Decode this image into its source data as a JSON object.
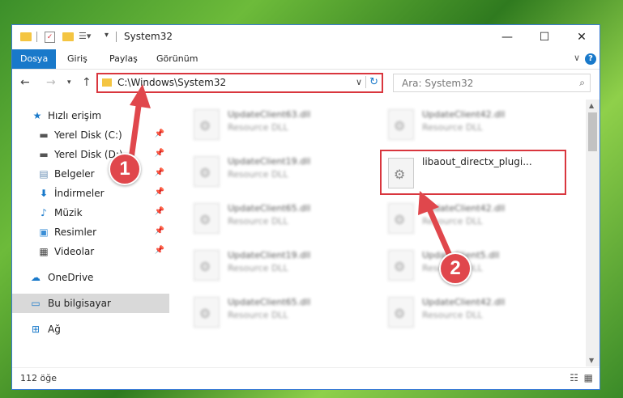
{
  "window": {
    "title": "System32",
    "controls": {
      "minimize": "—",
      "maximize": "☐",
      "close": "✕"
    }
  },
  "ribbon": {
    "tabs": [
      "Dosya",
      "Giriş",
      "Paylaş",
      "Görünüm"
    ],
    "active_tab": "Dosya"
  },
  "address": {
    "path": "C:\\Windows\\System32",
    "search_placeholder": "Ara: System32"
  },
  "nav": {
    "items": [
      {
        "label": "Hızlı erişim",
        "icon": "star-icon",
        "pinned": false
      },
      {
        "label": "Yerel Disk (C:)",
        "icon": "drive-icon",
        "pinned": true
      },
      {
        "label": "Yerel Disk (D:)",
        "icon": "drive-icon",
        "pinned": true
      },
      {
        "label": "Belgeler",
        "icon": "documents-icon",
        "pinned": true
      },
      {
        "label": "İndirmeler",
        "icon": "download-icon",
        "pinned": true
      },
      {
        "label": "Müzik",
        "icon": "music-icon",
        "pinned": true
      },
      {
        "label": "Resimler",
        "icon": "pictures-icon",
        "pinned": true
      },
      {
        "label": "Videolar",
        "icon": "videos-icon",
        "pinned": true
      },
      {
        "label": "OneDrive",
        "icon": "cloud-icon",
        "pinned": false
      },
      {
        "label": "Bu bilgisayar",
        "icon": "computer-icon",
        "pinned": false,
        "selected": true
      },
      {
        "label": "Ağ",
        "icon": "network-icon",
        "pinned": false
      }
    ]
  },
  "files": [
    {
      "name": "UpdateClient63.dll",
      "type": "Resource DLL"
    },
    {
      "name": "UpdateClient42.dll",
      "type": "Resource DLL"
    },
    {
      "name": "UpdateClient19.dll",
      "type": "Resource DLL"
    },
    {
      "name": "libaout_directx_plugi...",
      "type": "",
      "highlighted": true
    },
    {
      "name": "UpdateClient65.dll",
      "type": "Resource DLL"
    },
    {
      "name": "UpdateClient42.dll",
      "type": "Resource DLL"
    },
    {
      "name": "UpdateClient19.dll",
      "type": "Resource DLL"
    },
    {
      "name": "UpdateClient5.dll",
      "type": "Resource DLL"
    },
    {
      "name": "UpdateClient65.dll",
      "type": "Resource DLL"
    },
    {
      "name": "UpdateClient42.dll",
      "type": "Resource DLL"
    }
  ],
  "status": {
    "item_count": "112 öğe"
  },
  "callouts": [
    "1",
    "2"
  ],
  "colors": {
    "accent": "#1979ca",
    "highlight": "#d9363e",
    "callout": "#e0474c"
  }
}
